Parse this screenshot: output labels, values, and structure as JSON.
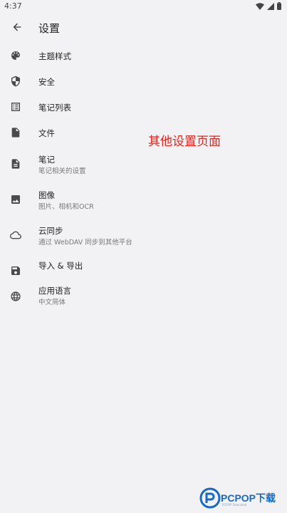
{
  "status_bar": {
    "time": "4:37",
    "icons": [
      "wifi-icon",
      "signal-icon",
      "battery-icon"
    ]
  },
  "app_bar": {
    "back_icon": "arrow-back-icon",
    "title": "设置"
  },
  "settings": [
    {
      "icon": "palette-icon",
      "title": "主题样式"
    },
    {
      "icon": "shield-icon",
      "title": "安全"
    },
    {
      "icon": "list-icon",
      "title": "笔记列表"
    },
    {
      "icon": "file-icon",
      "title": "文件"
    },
    {
      "icon": "document-icon",
      "title": "笔记",
      "subtitle": "笔记相关的设置"
    },
    {
      "icon": "image-icon",
      "title": "图像",
      "subtitle": "图片、相机和OCR"
    },
    {
      "icon": "cloud-icon",
      "title": "云同步",
      "subtitle": "通过 WebDAV 同步到其他平台"
    },
    {
      "icon": "save-icon",
      "title": "导入 & 导出"
    },
    {
      "icon": "globe-icon",
      "title": "应用语言",
      "subtitle": "中文简体"
    }
  ],
  "overlay_caption": "其他设置页面",
  "watermark": {
    "brand": "PCPOP下载",
    "tagline": "PCPOP Download"
  },
  "colors": {
    "background": "#f2f2f4",
    "icon": "#4a4a4a",
    "caption": "#e0241e",
    "watermark": "#1769c2"
  }
}
